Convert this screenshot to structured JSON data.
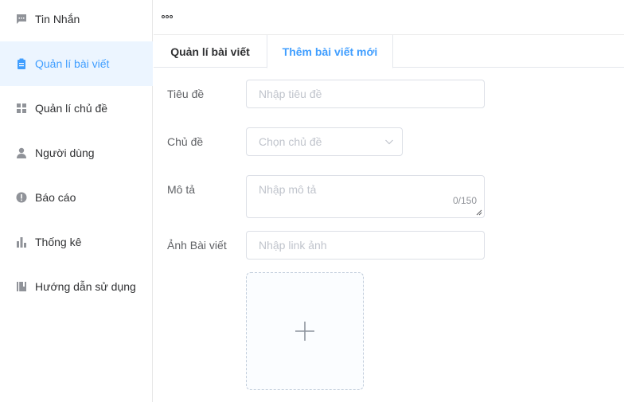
{
  "sidebar": {
    "items": [
      {
        "label": "Tin Nhắn",
        "icon": "chat-icon"
      },
      {
        "label": "Quản lí bài viết",
        "icon": "clipboard-icon"
      },
      {
        "label": "Quản lí chủ đề",
        "icon": "grid-icon"
      },
      {
        "label": "Người dùng",
        "icon": "user-icon"
      },
      {
        "label": "Báo cáo",
        "icon": "warning-icon"
      },
      {
        "label": "Thống kê",
        "icon": "bar-chart-icon"
      },
      {
        "label": "Hướng dẫn sử dụng",
        "icon": "book-icon"
      }
    ],
    "active_index": 1
  },
  "tabs": [
    {
      "label": "Quản lí bài viết"
    },
    {
      "label": "Thêm bài viết mới"
    }
  ],
  "form": {
    "title_label": "Tiêu đề",
    "title_placeholder": "Nhập tiêu đề",
    "topic_label": "Chủ đề",
    "topic_placeholder": "Chọn chủ đề",
    "desc_label": "Mô tả",
    "desc_placeholder": "Nhập mô tả",
    "desc_counter": "0/150",
    "image_label": "Ảnh Bài viết",
    "image_placeholder": "Nhập link ảnh"
  },
  "colors": {
    "accent": "#409eff",
    "active_bg": "#ecf5ff",
    "border": "#dcdfe6",
    "placeholder": "#c0c4cc"
  }
}
